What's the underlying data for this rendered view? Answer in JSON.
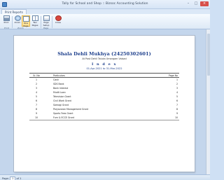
{
  "window": {
    "title": "Tally for School and Shop :: Bizsoc Accounting Solution",
    "controls": {
      "minimize": "–",
      "maximize": "□",
      "close": "×"
    }
  },
  "ribbon": {
    "tab": "Print Reports",
    "buttons": [
      {
        "label": "Print",
        "icon": "printer-icon"
      },
      {
        "label": "Zoom",
        "icon": "zoom-icon"
      },
      {
        "label": "One Page",
        "icon": "one-page-icon",
        "active": true
      },
      {
        "label": "Two Pages",
        "icon": "two-pages-icon"
      },
      {
        "label": "Page Setup",
        "icon": "page-setup-icon"
      },
      {
        "label": "Close",
        "icon": "close-icon"
      }
    ],
    "groups": {
      "print": "Print",
      "zoom": "Zoom",
      "page": "Page",
      "close": "Close"
    }
  },
  "document": {
    "company": "Shala Dehli Mukhya (24250302601)",
    "subtitle": "At Post Dehli Taluka Umargam Valsad",
    "heading": "I n d e x",
    "period": "01-Apr-2021 to 31-Mar-2022",
    "columns": {
      "sno": "Sr. No",
      "particulars": "Particulars",
      "page": "Page No"
    },
    "rows": [
      {
        "sno": "1",
        "particulars": "Cash",
        "page": "1"
      },
      {
        "sno": "2",
        "particulars": "SDS Bank",
        "page": "2"
      },
      {
        "sno": "3",
        "particulars": "Bank Interest",
        "page": "3"
      },
      {
        "sno": "4",
        "particulars": "Mudit Loan",
        "page": "4"
      },
      {
        "sno": "5",
        "particulars": "Television Grant",
        "page": "5"
      },
      {
        "sno": "6",
        "particulars": "Civil Work Grant",
        "page": "6"
      },
      {
        "sno": "7",
        "particulars": "Samagi Grant",
        "page": "7"
      },
      {
        "sno": "8",
        "particulars": "Paryavaran Management Grant",
        "page": "8"
      },
      {
        "sno": "9",
        "particulars": "Sports Fees Grant",
        "page": "9"
      },
      {
        "sno": "10",
        "particulars": "Furn & ECCE Grant",
        "page": "10"
      }
    ]
  },
  "status": {
    "page_label": "Page:",
    "page_value": "1",
    "of_label": "of 1"
  }
}
